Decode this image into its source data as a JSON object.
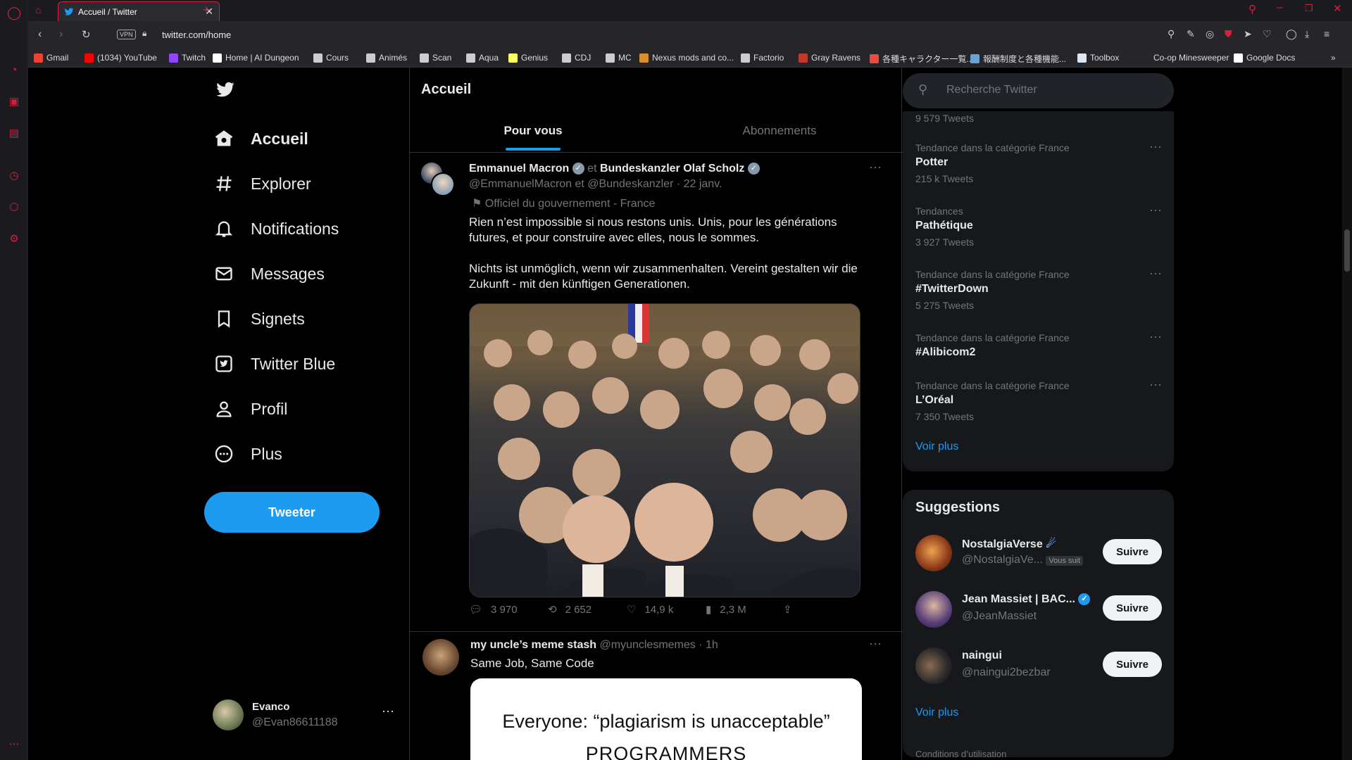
{
  "browser": {
    "tab_title": "Accueil / Twitter",
    "vpn_label": "VPN",
    "url": "twitter.com/home",
    "bookmarks": [
      {
        "label": "Gmail",
        "color": "#ea4335"
      },
      {
        "label": "(1034) YouTube",
        "color": "#ff0000"
      },
      {
        "label": "Twitch",
        "color": "#9146ff"
      },
      {
        "label": "Home | AI Dungeon",
        "color": "#ffffff"
      },
      {
        "label": "Cours",
        "color": "#cccccc"
      },
      {
        "label": "Animés",
        "color": "#cccccc"
      },
      {
        "label": "Scan",
        "color": "#cccccc"
      },
      {
        "label": "Aqua",
        "color": "#cccccc"
      },
      {
        "label": "Genius",
        "color": "#ffff64"
      },
      {
        "label": "CDJ",
        "color": "#cccccc"
      },
      {
        "label": "MC",
        "color": "#cccccc"
      },
      {
        "label": "Nexus mods and co...",
        "color": "#d98f30"
      },
      {
        "label": "Factorio",
        "color": "#cccccc"
      },
      {
        "label": "Gray Ravens",
        "color": "#c0392b"
      },
      {
        "label": "各種キャラクター一覧...",
        "color": "#e74c3c"
      },
      {
        "label": "報酬制度と各種機能...",
        "color": "#6aa2d8"
      },
      {
        "label": "Toolbox",
        "color": "#dde7f2"
      },
      {
        "label": "Co-op Minesweeper",
        "color": "#25252a"
      },
      {
        "label": "Google Docs",
        "color": "#ffffff"
      }
    ]
  },
  "sidebar": {
    "items": [
      {
        "label": "Accueil",
        "icon": "home-icon"
      },
      {
        "label": "Explorer",
        "icon": "hashtag-icon"
      },
      {
        "label": "Notifications",
        "icon": "bell-icon"
      },
      {
        "label": "Messages",
        "icon": "envelope-icon"
      },
      {
        "label": "Signets",
        "icon": "bookmark-icon"
      },
      {
        "label": "Twitter Blue",
        "icon": "twitter-blue-icon"
      },
      {
        "label": "Profil",
        "icon": "person-icon"
      },
      {
        "label": "Plus",
        "icon": "more-circle-icon"
      }
    ],
    "tweet_button": "Tweeter",
    "account": {
      "name": "Evanco",
      "handle": "@Evan86611188"
    }
  },
  "timeline": {
    "title": "Accueil",
    "tabs": [
      "Pour vous",
      "Abonnements"
    ],
    "tweet1": {
      "author1": "Emmanuel Macron",
      "joiner": "et",
      "author2": "Bundeskanzler Olaf Scholz",
      "handles": "@EmmanuelMacron et @Bundeskanzler · 22 janv.",
      "label": "Officiel du gouvernement - France",
      "text_fr": "Rien n’est impossible si nous restons unis. Unis, pour les générations futures, et pour construire avec elles, nous le sommes.",
      "text_de": "Nichts ist unmöglich, wenn wir zusammenhalten. Vereint gestalten wir die Zukunft - mit den künftigen Generationen.",
      "replies": "3 970",
      "retweets": "2 652",
      "likes": "14,9 k",
      "views": "2,3 M"
    },
    "tweet2": {
      "author": "my uncle’s meme stash",
      "handle": "@myunclesmemes · 1h",
      "text": "Same Job, Same Code",
      "meme_line1": "Everyone: “plagiarism is unacceptable”",
      "meme_line2": "PROGRAMMERS"
    }
  },
  "right": {
    "search_placeholder": "Recherche Twitter",
    "top_count": "9 579 Tweets",
    "trends": [
      {
        "category": "Tendance dans la catégorie France",
        "name": "Potter",
        "count": "215 k Tweets"
      },
      {
        "category": "Tendances",
        "name": "Pathétique",
        "count": "3 927 Tweets"
      },
      {
        "category": "Tendance dans la catégorie France",
        "name": "#TwitterDown",
        "count": "5 275 Tweets"
      },
      {
        "category": "Tendance dans la catégorie France",
        "name": "#Alibicom2",
        "count": ""
      },
      {
        "category": "Tendance dans la catégorie France",
        "name": "L’Oréal",
        "count": "7 350 Tweets"
      }
    ],
    "see_more": "Voir plus",
    "suggestions_title": "Suggestions",
    "suggestions": [
      {
        "name": "NostalgiaVerse",
        "handle": "@NostalgiaVe...",
        "badge": "Vous suit",
        "button": "Suivre"
      },
      {
        "name": "Jean Massiet | BAC...",
        "handle": "@JeanMassiet",
        "badge": "",
        "button": "Suivre"
      },
      {
        "name": "naingui",
        "handle": "@naingui2bezbar",
        "badge": "",
        "button": "Suivre"
      }
    ],
    "see_more2": "Voir plus",
    "footer": "Conditions d’utilisation"
  },
  "colors": {
    "accent": "#1d9bf0",
    "opera_red": "#d0223d",
    "background": "#000000"
  }
}
